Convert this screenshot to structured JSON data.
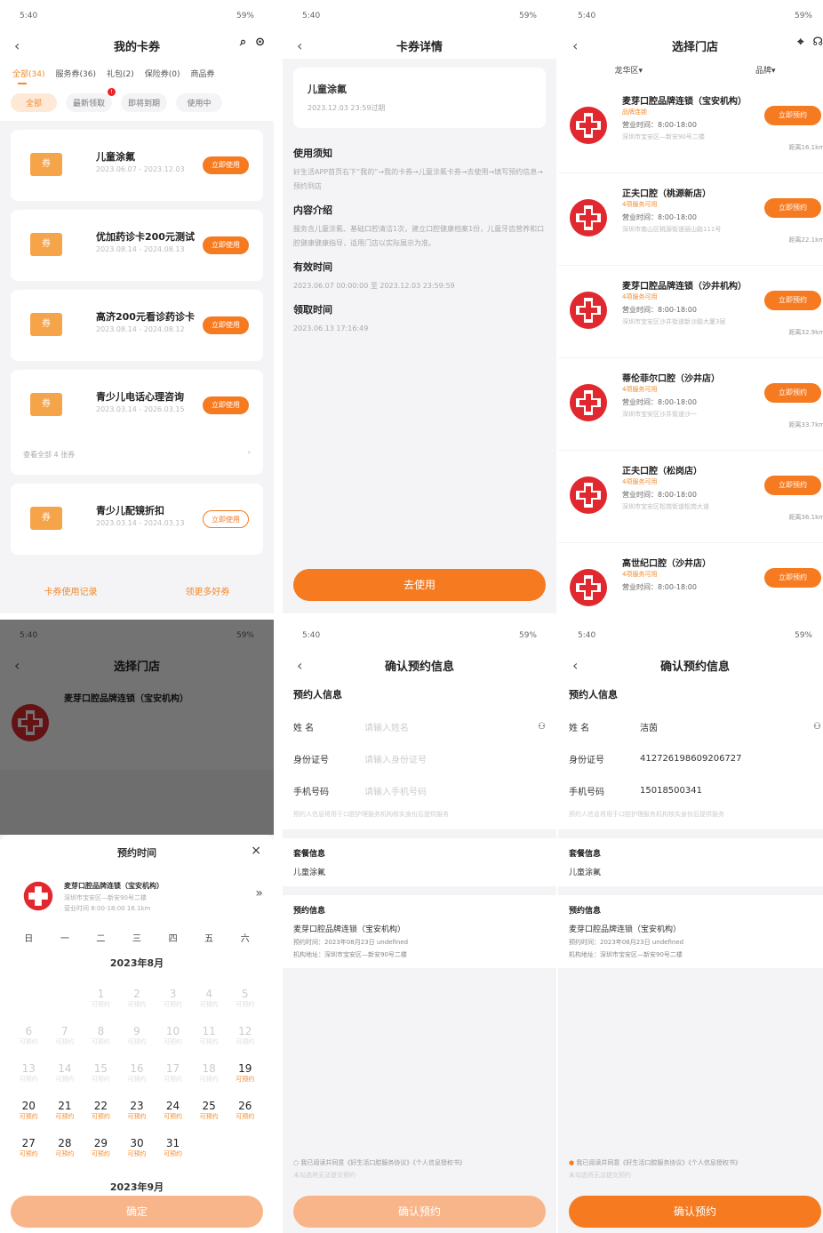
{
  "status": {
    "time": "5:40",
    "battery": "59%"
  },
  "s1": {
    "title": "我的卡券",
    "tabs": [
      "全部(34)",
      "服务券(36)",
      "礼包(2)",
      "保险券(0)",
      "商品券"
    ],
    "chips": [
      "全部",
      "最新领取",
      "即将到期",
      "使用中"
    ],
    "cards": [
      {
        "title": "儿童涂氟",
        "date": "2023.06.07 - 2023.12.03",
        "btn": "立即使用"
      },
      {
        "title": "优加药诊卡200元测试",
        "date": "2023.08.14 - 2024.08.13",
        "btn": "立即使用"
      },
      {
        "title": "高济200元看诊药诊卡",
        "date": "2023.08.14 - 2024.08.12",
        "btn": "立即使用"
      },
      {
        "title": "青少儿电话心理咨询",
        "date": "2023.03.14 - 2026.03.15",
        "btn": "立即使用"
      },
      {
        "title": "青少儿配镜折扣",
        "date": "2023.03.14 - 2024.03.13",
        "btn": "立即使用"
      }
    ],
    "more": "查看全部 4 张券",
    "footer_left": "卡券使用记录",
    "footer_right": "领更多好券"
  },
  "s2": {
    "title": "卡券详情",
    "card_title": "儿童涂氟",
    "card_date": "2023.12.03 23:59过期",
    "sec1": "使用须知",
    "p1": "好生活APP首页右下“我的”→我的卡券→儿童涂氟卡券→去使用→填写预约信息→预约到店",
    "sec2": "内容介绍",
    "p2": "服务含儿童涂氟、基础口腔清洁1次，建立口腔健康档案1份，儿童牙齿营养和口腔健康健康指导，适用门店以实际展示为准。",
    "sec3": "有效时间",
    "p3": "2023.06.07 00:00:00 至 2023.12.03 23:59:59",
    "sec4": "领取时间",
    "p4": "2023.06.13 17:16:49",
    "btn": "去使用"
  },
  "s3": {
    "title": "选择门店",
    "filter1": "龙华区",
    "filter2": "品牌",
    "stores": [
      {
        "name": "麦芽口腔品牌连锁（宝安机构）",
        "tag": "品牌连锁",
        "hours": "营业时间：8:00-18:00",
        "addr": "深圳市宝安区—新安90号二楼",
        "dist": "距离16.1km"
      },
      {
        "name": "正夫口腔（桃源新店）",
        "tag": "4项服务可用",
        "hours": "营业时间：8:00-18:00",
        "addr": "深圳市南山区桃源街道丽山路111号",
        "dist": "距离22.1km"
      },
      {
        "name": "麦芽口腔品牌连锁（沙井机构）",
        "tag": "4项服务可用",
        "hours": "营业时间：8:00-18:00",
        "addr": "深圳市宝安区沙井街道新沙路大厦3层",
        "dist": "距离32.9km"
      },
      {
        "name": "蒂伦菲尔口腔（沙井店）",
        "tag": "4项服务可用",
        "hours": "营业时间：8:00-18:00",
        "addr": "深圳市宝安区沙井街道沙一",
        "dist": "距离33.7km"
      },
      {
        "name": "正夫口腔（松岗店）",
        "tag": "4项服务可用",
        "hours": "营业时间：8:00-18:00",
        "addr": "深圳市宝安区松岗街道松岗大道",
        "dist": "距离36.1km"
      },
      {
        "name": "高世纪口腔（沙井店）",
        "tag": "4项服务可用",
        "hours": "营业时间：8:00-18:00",
        "addr": "",
        "dist": ""
      }
    ],
    "btn": "立即预约"
  },
  "s4": {
    "sheet_title": "预约时间",
    "store": "麦芽口腔品牌连锁（宝安机构）",
    "store_addr": "深圳市宝安区—新安90号二楼",
    "store_meta": "营业时间 8:00-18:00  16.1km",
    "weekdays": [
      "日",
      "一",
      "二",
      "三",
      "四",
      "五",
      "六"
    ],
    "month": "2023年8月",
    "month2": "2023年9月",
    "avail": "可预约",
    "btn": "确定"
  },
  "s5": {
    "title": "确认预约信息",
    "sec": "预约人信息",
    "name_k": "姓    名",
    "name_ph": "请输入姓名",
    "id_k": "身份证号",
    "id_ph": "请输入身份证号",
    "phone_k": "手机号码",
    "phone_ph": "请输入手机号码",
    "note": "预约人信息将用于口腔护理服务机构核实身份后提供服务",
    "pkg_k": "套餐信息",
    "pkg_v": "儿童涂氟",
    "appt_k": "预约信息",
    "appt_store": "麦芽口腔品牌连锁（宝安机构）",
    "appt_time": "预约时间：2023年08月23日 undefined",
    "appt_addr": "机构地址：深圳市宝安区—新安90号二楼",
    "agree": "我已阅读并同意《好生活口腔服务协议》《个人信息授权书》",
    "agree2": "未勾选将无法提交预约",
    "btn": "确认预约"
  },
  "s6": {
    "name_v": "洁茵",
    "id_v": "412726198609206727",
    "phone_v": "15018500341"
  }
}
